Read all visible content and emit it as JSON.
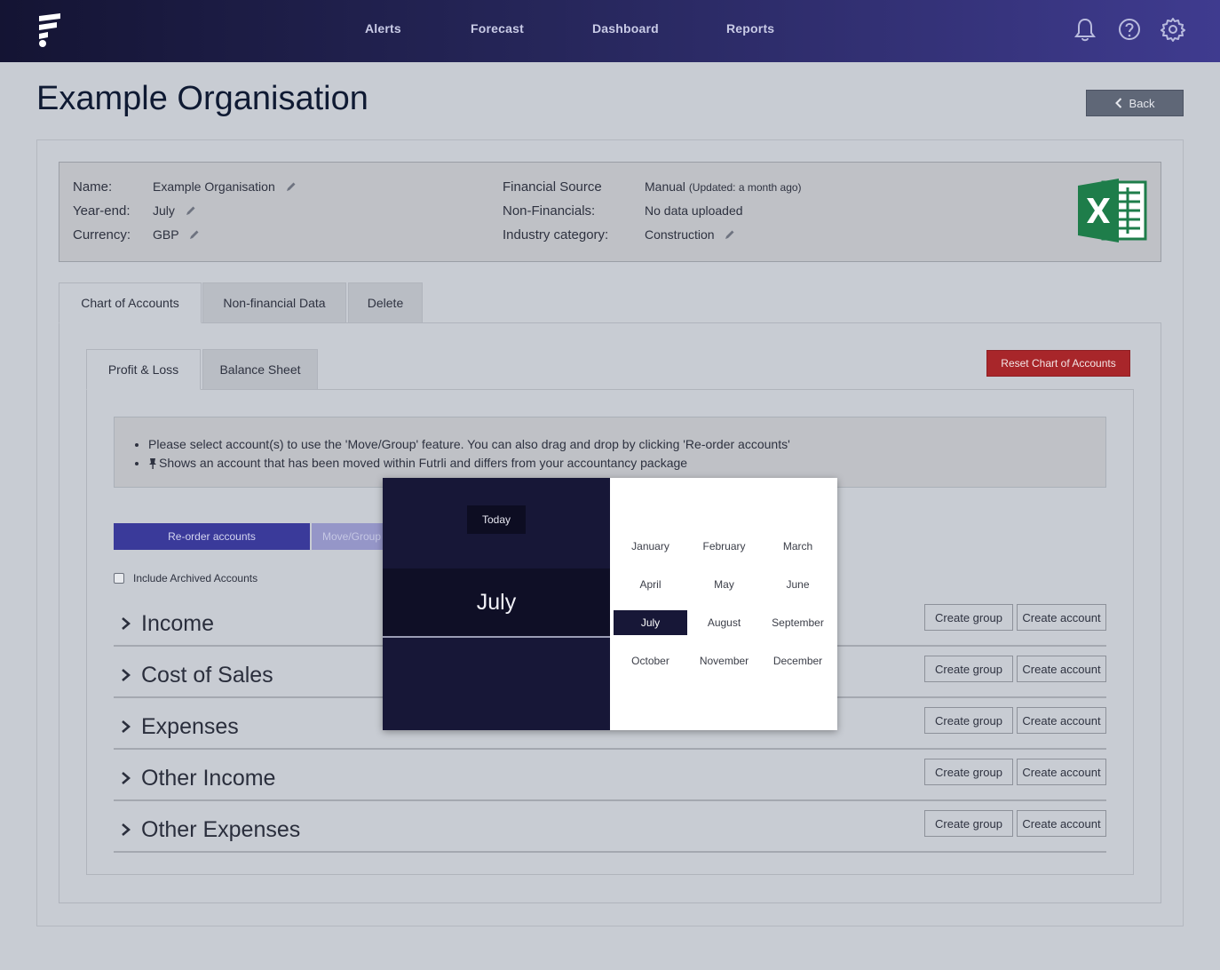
{
  "nav": {
    "items": [
      {
        "label": "Alerts"
      },
      {
        "label": "Forecast"
      },
      {
        "label": "Dashboard"
      },
      {
        "label": "Reports"
      }
    ],
    "icons": [
      "bell-icon",
      "help-icon",
      "gear-icon"
    ]
  },
  "page": {
    "title": "Example Organisation",
    "back_label": "Back"
  },
  "org": {
    "name_label": "Name:",
    "name_value": "Example Organisation",
    "yearend_label": "Year-end:",
    "yearend_value": "July",
    "currency_label": "Currency:",
    "currency_value": "GBP",
    "source_label": "Financial Source",
    "source_value": "Manual",
    "source_updated": "(Updated: a month ago)",
    "nonfin_label": "Non-Financials:",
    "nonfin_value": "No data uploaded",
    "industry_label": "Industry category:",
    "industry_value": "Construction"
  },
  "tabs": {
    "main": [
      {
        "label": "Chart of Accounts",
        "active": true
      },
      {
        "label": "Non-financial Data",
        "active": false
      },
      {
        "label": "Delete",
        "active": false
      }
    ],
    "sub": [
      {
        "label": "Profit & Loss",
        "active": true
      },
      {
        "label": "Balance Sheet",
        "active": false
      }
    ]
  },
  "reset_label": "Reset Chart of Accounts",
  "notice": {
    "line1": "Please select account(s) to use the 'Move/Group' feature. You can also drag and drop by clicking 'Re-order accounts'",
    "line2": "Shows an account that has been moved within Futrli and differs from your accountancy package"
  },
  "reorder_label": "Re-order accounts",
  "move_label": "Move/Group",
  "archived_label": "Include Archived Accounts",
  "sections": [
    {
      "title": "Income"
    },
    {
      "title": "Cost of Sales"
    },
    {
      "title": "Expenses"
    },
    {
      "title": "Other Income"
    },
    {
      "title": "Other Expenses"
    }
  ],
  "section_buttons": {
    "create_group": "Create group",
    "create_account": "Create account"
  },
  "picker": {
    "today_label": "Today",
    "selected_month": "July",
    "months": [
      "January",
      "February",
      "March",
      "April",
      "May",
      "June",
      "July",
      "August",
      "September",
      "October",
      "November",
      "December"
    ]
  },
  "colors": {
    "nav_gradient_start": "#141433",
    "nav_gradient_end": "#3f3b8f",
    "reset_red": "#a8262a",
    "reorder_blue": "#3a3a9a",
    "picker_dark": "#171737",
    "excel_green": "#1e7d4a"
  }
}
